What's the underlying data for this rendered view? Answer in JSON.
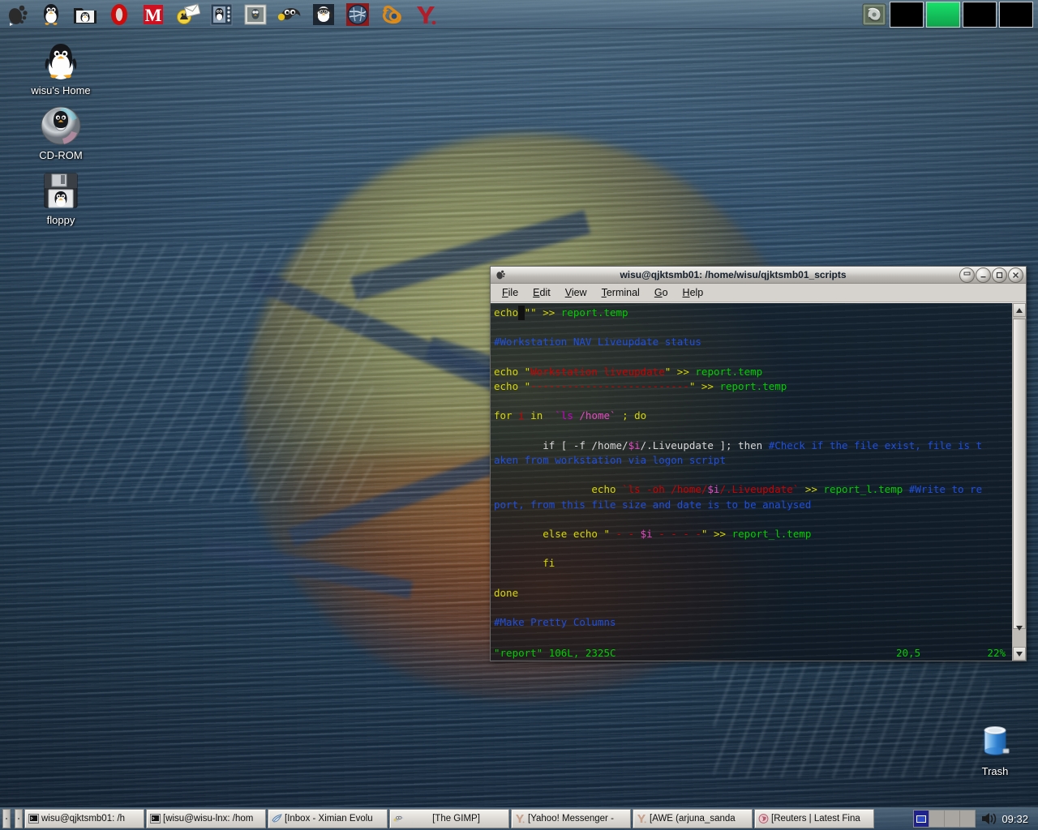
{
  "desktop": {
    "wallpaper_description": "water surface reflection",
    "icons": [
      {
        "name": "home",
        "label": "wisu's Home",
        "icon": "penguin-home-icon"
      },
      {
        "name": "cdrom",
        "label": "CD-ROM",
        "icon": "cdrom-disc-icon"
      },
      {
        "name": "floppy",
        "label": "floppy",
        "icon": "floppy-disk-icon"
      },
      {
        "name": "trash",
        "label": "Trash",
        "icon": "trash-can-icon"
      }
    ]
  },
  "top_panel": {
    "launchers": [
      {
        "name": "main-menu",
        "icon": "gnome-foot-icon",
        "tooltip": "Main Menu"
      },
      {
        "name": "penguin-app",
        "icon": "penguin-icon",
        "tooltip": "Penguin"
      },
      {
        "name": "file-manager",
        "icon": "folder-penguin-icon",
        "tooltip": "File Manager"
      },
      {
        "name": "opera",
        "icon": "opera-o-icon",
        "tooltip": "Opera"
      },
      {
        "name": "mozilla",
        "icon": "mozilla-m-icon",
        "tooltip": "Mozilla"
      },
      {
        "name": "mail",
        "icon": "mail-envelope-icon",
        "tooltip": "Mail"
      },
      {
        "name": "photo-app",
        "icon": "penguin-frame-icon",
        "tooltip": "Images"
      },
      {
        "name": "viewer",
        "icon": "image-viewer-icon",
        "tooltip": "Viewer"
      },
      {
        "name": "gimp",
        "icon": "gimp-wilber-icon",
        "tooltip": "The GIMP"
      },
      {
        "name": "audio",
        "icon": "penguin-headphones-icon",
        "tooltip": "Audio Player"
      },
      {
        "name": "globe-app",
        "icon": "globe-disc-icon",
        "tooltip": "Globe"
      },
      {
        "name": "blender",
        "icon": "blender-icon",
        "tooltip": "Blender"
      },
      {
        "name": "yahoo",
        "icon": "yahoo-y-icon",
        "tooltip": "Yahoo!"
      }
    ],
    "disk_mount": {
      "name": "disk-mounter",
      "icon": "hard-disk-icon"
    },
    "pager": {
      "count": 4,
      "active_index": 1
    }
  },
  "window": {
    "title": "wisu@qjktsmb01: /home/wisu/qjktsmb01_scripts",
    "icon": "gnome-terminal-icon",
    "buttons": [
      {
        "name": "shade-button",
        "icon": "shade-icon"
      },
      {
        "name": "minimize-button",
        "icon": "minimize-icon"
      },
      {
        "name": "maximize-button",
        "icon": "maximize-icon"
      },
      {
        "name": "close-button",
        "icon": "close-icon"
      }
    ],
    "menus": [
      {
        "name": "file",
        "label": "File",
        "mnemonic": "F"
      },
      {
        "name": "edit",
        "label": "Edit",
        "mnemonic": "E"
      },
      {
        "name": "view",
        "label": "View",
        "mnemonic": "V"
      },
      {
        "name": "terminal",
        "label": "Terminal",
        "mnemonic": "T"
      },
      {
        "name": "go",
        "label": "Go",
        "mnemonic": "G"
      },
      {
        "name": "help",
        "label": "Help",
        "mnemonic": "H"
      }
    ],
    "scrollbar": {
      "up_arrow": "scroll-up-icon",
      "down_arrow": "scroll-down-icon"
    }
  },
  "terminal": {
    "editor": "vim",
    "status": {
      "file": "\"report\" 106L, 2325C",
      "position": "20,5",
      "percent": "22%"
    },
    "lines": [
      [
        {
          "t": "echo",
          "c": "kw"
        },
        {
          "t": "",
          "c": "cursor"
        },
        {
          "t": "\"\"",
          "c": "kw"
        },
        {
          "t": " ",
          "c": "wht"
        },
        {
          "t": ">>",
          "c": "kw"
        },
        {
          "t": " ",
          "c": "wht"
        },
        {
          "t": "report.temp",
          "c": "grn"
        }
      ],
      [],
      [
        {
          "t": "#Workstation NAV Liveupdate status",
          "c": "blu"
        }
      ],
      [],
      [
        {
          "t": "echo ",
          "c": "kw"
        },
        {
          "t": "\"",
          "c": "kw"
        },
        {
          "t": "Workstation liveupdate",
          "c": "str"
        },
        {
          "t": "\"",
          "c": "kw"
        },
        {
          "t": " >> ",
          "c": "kw"
        },
        {
          "t": "report.temp",
          "c": "grn"
        }
      ],
      [
        {
          "t": "echo ",
          "c": "kw"
        },
        {
          "t": "\"",
          "c": "kw"
        },
        {
          "t": "--------------------------",
          "c": "str"
        },
        {
          "t": "\"",
          "c": "kw"
        },
        {
          "t": " >> ",
          "c": "kw"
        },
        {
          "t": "report.temp",
          "c": "grn"
        }
      ],
      [],
      [
        {
          "t": "for ",
          "c": "kw"
        },
        {
          "t": "i",
          "c": "red"
        },
        {
          "t": " in  ",
          "c": "kw"
        },
        {
          "t": "`ls",
          "c": "mag"
        },
        {
          "t": " ",
          "c": "wht"
        },
        {
          "t": "/home`",
          "c": "pnk"
        },
        {
          "t": " ; do",
          "c": "kw"
        }
      ],
      [],
      [
        {
          "t": "        if [ -f ",
          "c": "wht"
        },
        {
          "t": "/home/",
          "c": "wht"
        },
        {
          "t": "$i",
          "c": "pnk"
        },
        {
          "t": "/.Liveupdate ]; then ",
          "c": "wht"
        },
        {
          "t": "#Check if the file exist, file is t",
          "c": "blu"
        }
      ],
      [
        {
          "t": "aken from workstation via logon script",
          "c": "blu"
        }
      ],
      [],
      [
        {
          "t": "                echo ",
          "c": "kw"
        },
        {
          "t": "`ls -oh /home/",
          "c": "red"
        },
        {
          "t": "$i",
          "c": "pnk"
        },
        {
          "t": "/.Liveupdate`",
          "c": "red"
        },
        {
          "t": " >> ",
          "c": "kw"
        },
        {
          "t": "report_l.temp",
          "c": "grn"
        },
        {
          "t": " ",
          "c": "wht"
        },
        {
          "t": "#Write to re",
          "c": "blu"
        }
      ],
      [
        {
          "t": "port, from this file size and date is to be analysed",
          "c": "blu"
        }
      ],
      [],
      [
        {
          "t": "        else echo ",
          "c": "kw"
        },
        {
          "t": "\"",
          "c": "kw"
        },
        {
          "t": " - - ",
          "c": "red"
        },
        {
          "t": "$i",
          "c": "pnk"
        },
        {
          "t": " - - - -",
          "c": "red"
        },
        {
          "t": "\"",
          "c": "kw"
        },
        {
          "t": " >> ",
          "c": "kw"
        },
        {
          "t": "report_l.temp",
          "c": "grn"
        }
      ],
      [],
      [
        {
          "t": "        fi",
          "c": "kw"
        }
      ],
      [],
      [
        {
          "t": "done",
          "c": "kw"
        }
      ],
      [],
      [
        {
          "t": "#Make Pretty Columns",
          "c": "blu"
        }
      ]
    ]
  },
  "taskbar": {
    "tasks": [
      {
        "name": "task-terminal-1",
        "icon": "terminal-icon",
        "label": "wisu@qjktsmb01: /h"
      },
      {
        "name": "task-terminal-2",
        "icon": "terminal-icon",
        "label": "[wisu@wisu-lnx: /hom"
      },
      {
        "name": "task-evolution",
        "icon": "evolution-icon",
        "label": "[Inbox - Ximian Evolu"
      },
      {
        "name": "task-gimp",
        "icon": "gimp-wilber-icon",
        "label": "[The GIMP]"
      },
      {
        "name": "task-yahoo-messenger",
        "icon": "yahoo-y-icon",
        "label": "[Yahoo! Messenger -"
      },
      {
        "name": "task-awe",
        "icon": "yahoo-y-icon",
        "label": "[AWE (arjuna_sanda"
      },
      {
        "name": "task-reuters",
        "icon": "mozilla-m-icon",
        "label": "[Reuters | Latest Fina"
      }
    ],
    "pager": {
      "count": 4,
      "active_index": 0
    },
    "volume_icon": "speaker-icon",
    "clock": "09:32"
  }
}
